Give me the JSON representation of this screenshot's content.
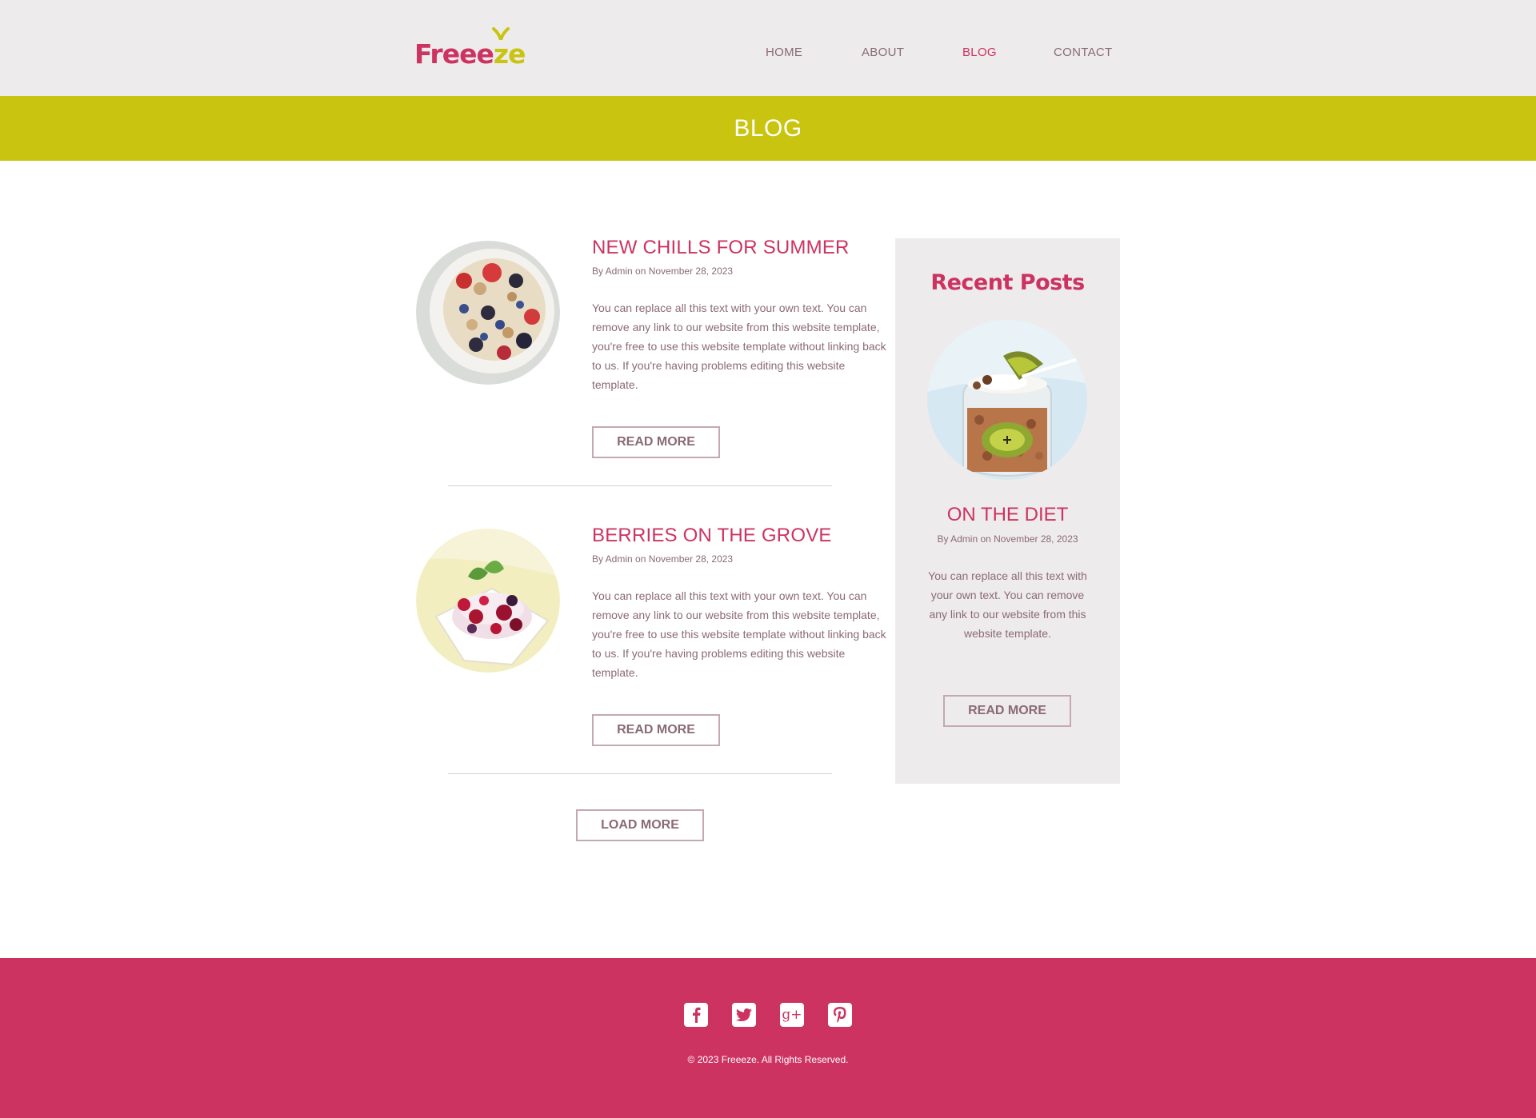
{
  "brand": {
    "logo_text_main": "Freee",
    "logo_text_end": "ze",
    "primary_color": "#cc3361",
    "accent_color": "#c8c40f",
    "header_bg": "#eeebec"
  },
  "nav": {
    "items": [
      {
        "label": "HOME"
      },
      {
        "label": "ABOUT"
      },
      {
        "label": "BLOG",
        "active": true
      },
      {
        "label": "CONTACT"
      }
    ]
  },
  "banner": {
    "title": "BLOG"
  },
  "posts": [
    {
      "title": "NEW CHILLS FOR SUMMER",
      "meta": "By Admin on November 28, 2023",
      "body": "You can replace all this text with your own text. You can remove any link to our website from this website template, you're free to use this website template without linking back to us. If you're having problems editing this website template.",
      "button": "READ MORE",
      "image": "granola-berries-bowl"
    },
    {
      "title": "BERRIES ON THE GROVE",
      "meta": "By Admin on November 28, 2023",
      "body": "You can replace all this text with your own text. You can remove any link to our website from this website template, you're free to use this website template without linking back to us. If you're having problems editing this website template.",
      "button": "READ MORE",
      "image": "berries-frozen-yogurt"
    }
  ],
  "load_more": "LOAD MORE",
  "sidebar": {
    "heading": "Recent Posts",
    "post": {
      "title": "ON THE DIET",
      "meta": "By Admin on November 28, 2023",
      "body": "You can replace all this text with your own text. You can remove any link to our website from this website template.",
      "button": "READ MORE",
      "image": "kiwi-granola-jar"
    }
  },
  "footer": {
    "social": [
      {
        "name": "facebook-icon",
        "glyph": "f"
      },
      {
        "name": "twitter-icon",
        "glyph": "t"
      },
      {
        "name": "google-plus-icon",
        "glyph": "g+"
      },
      {
        "name": "pinterest-icon",
        "glyph": "p"
      }
    ],
    "copyright": "© 2023 Freeeze. All Rights Reserved."
  }
}
